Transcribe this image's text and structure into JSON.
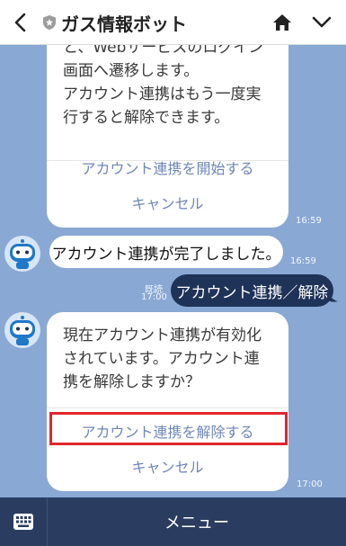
{
  "header": {
    "title": "ガス情報ボット",
    "back_icon": "chevron-left-icon",
    "home_icon": "home-icon",
    "menu_icon": "chevron-down-icon"
  },
  "card1": {
    "text": "と、Webサービスのログイン\n画面へ遷移します。\nアカウント連携はもう一度実\n行すると解除できます。",
    "actions": [
      "アカウント連携を開始する",
      "キャンセル"
    ],
    "time": "16:59"
  },
  "message_in": {
    "text": "アカウント連携が完了しました。",
    "time": "16:59"
  },
  "message_out": {
    "text": "アカウント連携／解除",
    "read": "既読",
    "time": "17:00"
  },
  "card2": {
    "text": "現在アカウント連携が有効化\nされています。アカウント連\n携を解除しますか？",
    "actions": [
      "アカウント連携を解除する",
      "キャンセル"
    ],
    "time": "17:00"
  },
  "bottom": {
    "menu_label": "メニュー",
    "keyboard_icon": "keyboard-icon"
  },
  "colors": {
    "background": "#8aa8d4",
    "outgoing": "#1f3358",
    "link": "#6f87b8",
    "highlight": "#e0262b"
  }
}
